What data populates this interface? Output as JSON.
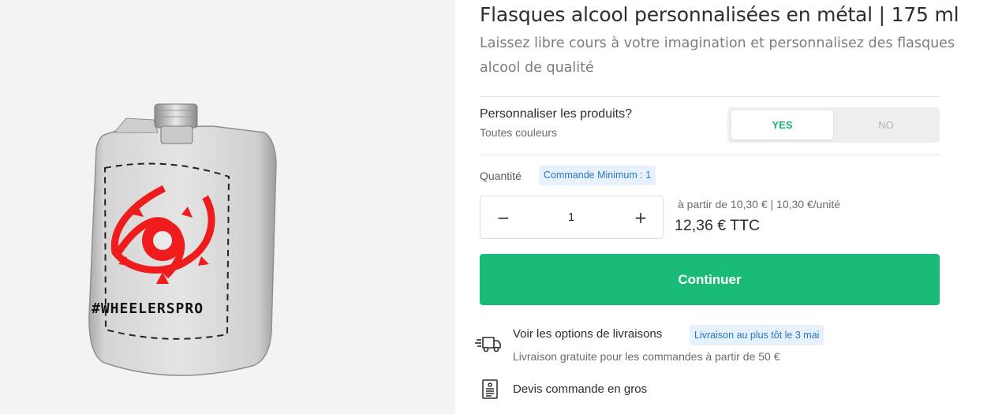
{
  "product": {
    "title": "Flasques alcool personnalisées en métal | 175 ml",
    "subtitle": "Laissez libre cours à votre imagination et personnalisez des flasques alcool de qualité",
    "design_text": "#WHEELERSPRO"
  },
  "personalize": {
    "label": "Personnaliser les produits?",
    "sub": "Toutes couleurs",
    "yes": "YES",
    "no": "NO",
    "selected": "YES"
  },
  "quantity": {
    "label": "Quantité",
    "min_badge": "Commande Minimum : 1",
    "value": "1",
    "minus": "−",
    "plus": "+"
  },
  "price": {
    "from": "à partir de 10,30 € | 10,30 €/unité",
    "ttc": "12,36 € TTC"
  },
  "cta": {
    "label": "Continuer"
  },
  "delivery": {
    "link": "Voir les options de livraisons",
    "badge": "Livraison au plus tôt le 3 mai",
    "free": "Livraison gratuite pour les commandes à partir de 50 €"
  },
  "quote": {
    "link": "Devis commande en gros"
  },
  "colors": {
    "accent": "#19bb76",
    "yes_text": "#19b36e",
    "badge_bg": "#e6f1fb",
    "badge_text": "#2a76c4",
    "design_red": "#ee1c1c"
  },
  "icons": {
    "delivery": "delivery-truck-icon",
    "quote": "quote-document-icon"
  }
}
